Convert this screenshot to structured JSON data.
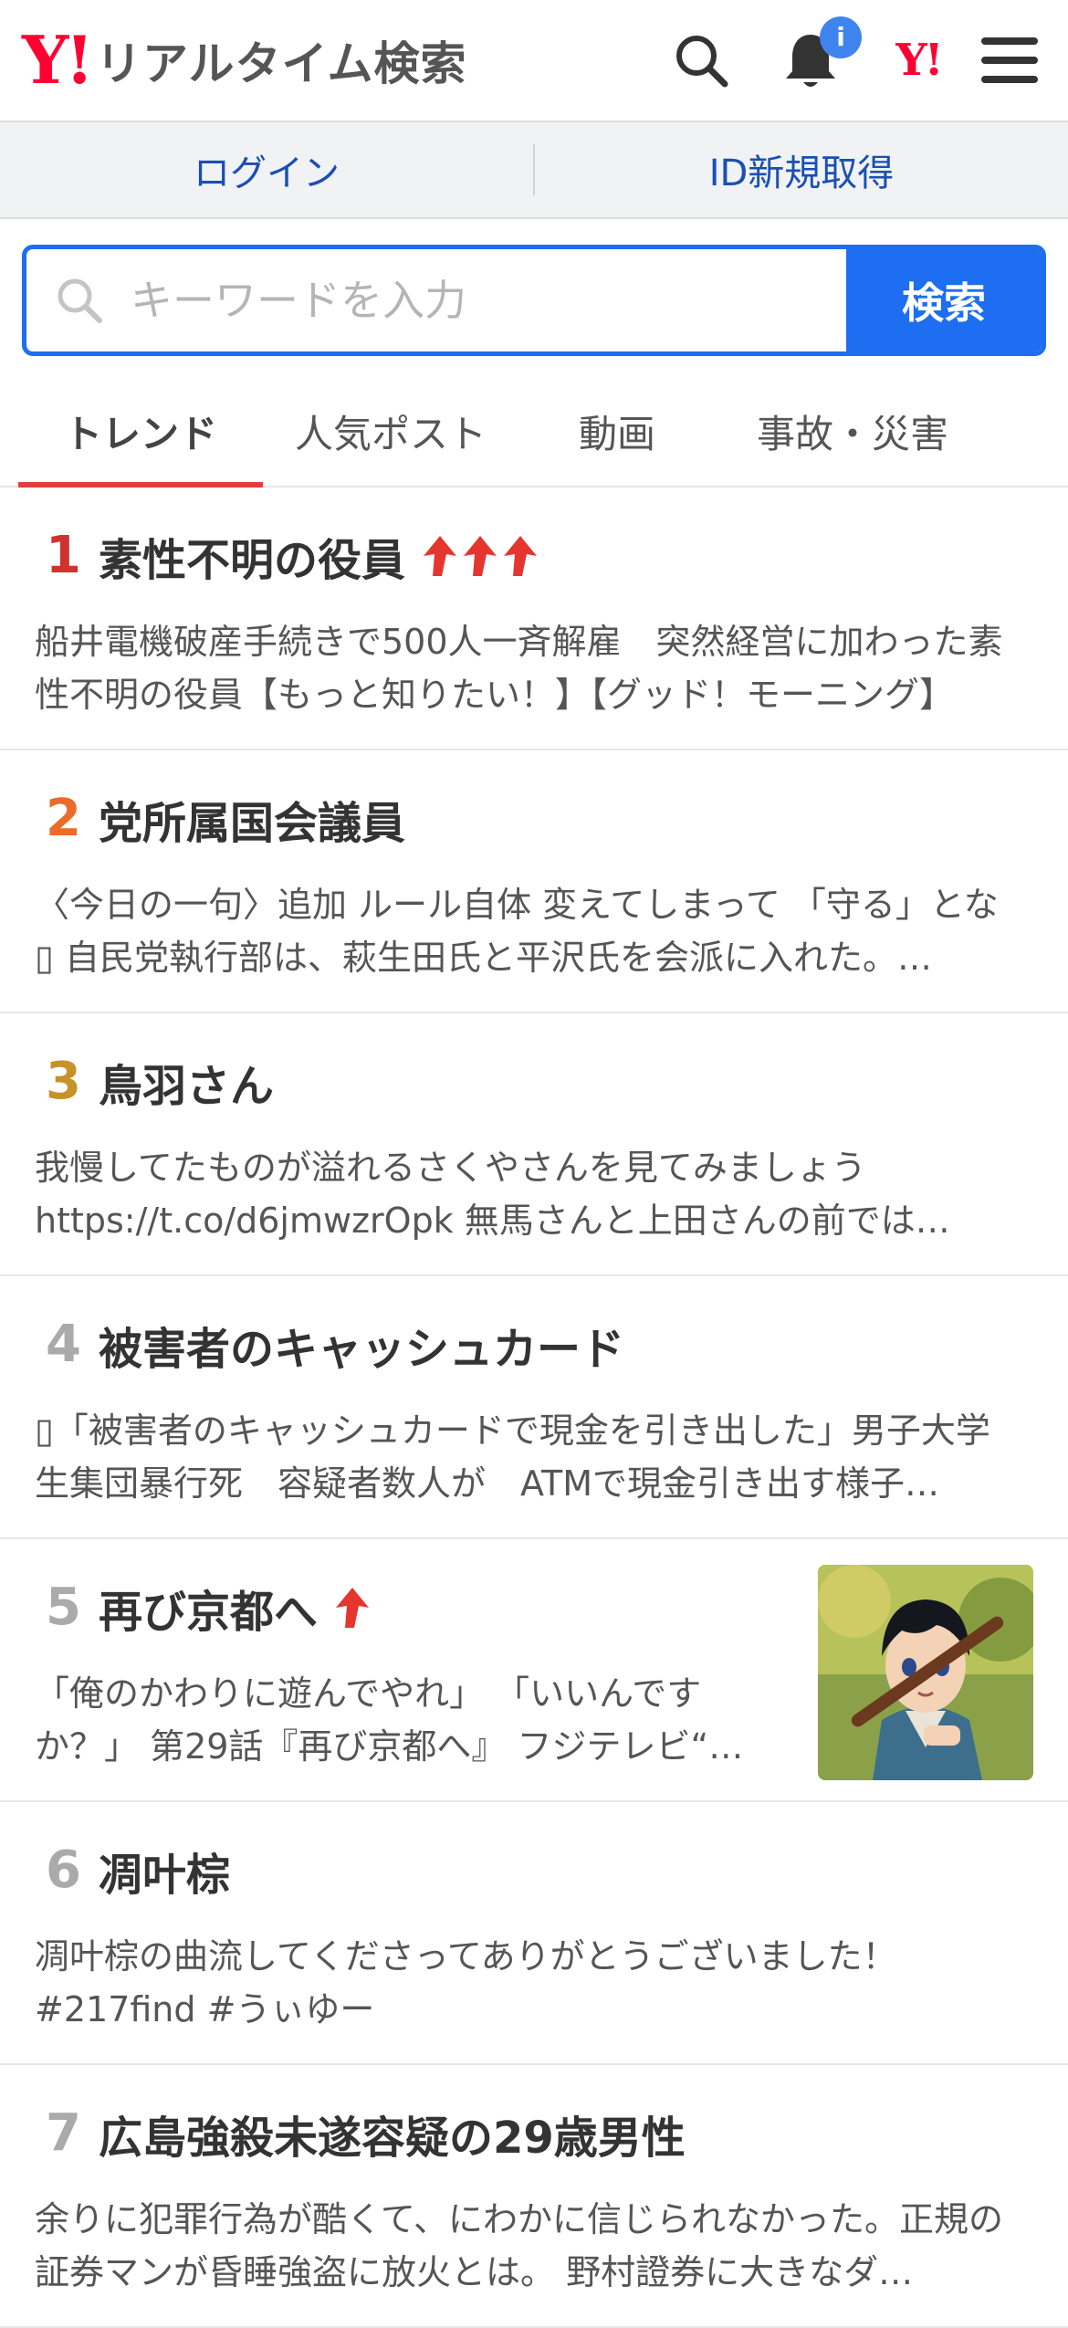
{
  "header": {
    "logo_mark": "Y!",
    "logo_text": "リアルタイム検索",
    "notification_badge": "i",
    "yj_mark": "Y!"
  },
  "loginbar": {
    "login": "ログイン",
    "register": "ID新規取得"
  },
  "search": {
    "placeholder": "キーワードを入力",
    "button": "検索"
  },
  "tabs": [
    {
      "label": "トレンド",
      "active": true
    },
    {
      "label": "人気ポスト"
    },
    {
      "label": "動画"
    },
    {
      "label": "事故・災害"
    }
  ],
  "colors": {
    "accent_blue": "#1d6ef0",
    "brand_red": "#ff0033",
    "rank1": "#d0332f",
    "rank2": "#ea6b2a",
    "rank3": "#c7922a",
    "rank_other": "#a8a8a8",
    "up_arrow": "#e5352f"
  },
  "trends": [
    {
      "rank": "1",
      "title": "素性不明の役員",
      "up_arrows": 3,
      "desc": "船井電機破産手続きで500人一斉解雇　突然経営に加わった素性不明の役員【もっと知りたい！】【グッド！モーニング】"
    },
    {
      "rank": "2",
      "title": "党所属国会議員",
      "up_arrows": 0,
      "desc": "〈今日の一句〉追加 ルール自体 変えてしまって 「守る」とな▯ 自民党執行部は、萩生田氏と平沢氏を会派に入れた。…"
    },
    {
      "rank": "3",
      "title": "鳥羽さん",
      "up_arrows": 0,
      "desc": "我慢してたものが溢れるさくやさんを見てみましょう https://t.co/d6jmwzrOpk 無馬さんと上田さんの前では…"
    },
    {
      "rank": "4",
      "title": "被害者のキャッシュカード",
      "up_arrows": 0,
      "desc": "▯「被害者のキャッシュカードで現金を引き出した」男子大学生集団暴行死　容疑者数人が　ATMで現金引き出す様子…"
    },
    {
      "rank": "5",
      "title": "再び京都へ",
      "up_arrows": 1,
      "desc": "「俺のかわりに遊んでやれ」 「いいんですか？」 第29話『再び京都へ』 フジテレビ“…"
    },
    {
      "rank": "6",
      "title": "凋叶棕",
      "up_arrows": 0,
      "desc": "凋叶棕の曲流してくださってありがとうございました！ #217find #うぃゆー"
    },
    {
      "rank": "7",
      "title": "広島強殺未遂容疑の29歳男性",
      "up_arrows": 0,
      "desc": "余りに犯罪行為が酷くて、にわかに信じられなかった。正規の証券マンが昏睡強盗に放火とは。 野村證券に大きなダ…"
    }
  ]
}
